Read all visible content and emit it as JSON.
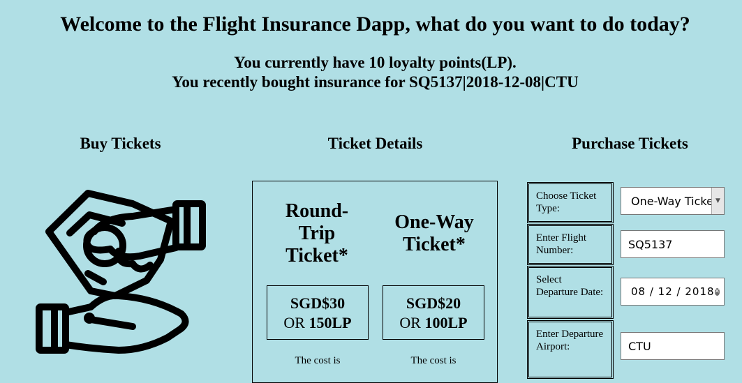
{
  "header": {
    "title": "Welcome to the Flight Insurance Dapp, what do you want to do today?",
    "loyalty_line": "You currently have 10 loyalty points(LP).",
    "recent_line": "You recently bought insurance for SQ5137|2018-12-08|CTU"
  },
  "sections": {
    "buy": "Buy Tickets",
    "details": "Ticket Details",
    "purchase": "Purchase Tickets"
  },
  "tickets": {
    "round_trip": {
      "name": "Round-Trip Ticket*",
      "price": "SGD$30",
      "or_text": "OR",
      "points": "150LP",
      "note": "The cost is"
    },
    "one_way": {
      "name": "One-Way Ticket*",
      "price": "SGD$20",
      "or_text": "OR",
      "points": "100LP",
      "note": "The cost is"
    }
  },
  "form": {
    "ticket_type_label": "Choose Ticket Type:",
    "ticket_type_value": "One-Way Ticket",
    "flight_label": "Enter Flight Number:",
    "flight_value": "SQ5137",
    "date_label": "Select Departure Date:",
    "date_value": "08 / 12 / 2018",
    "airport_label": "Enter Departure Airport:",
    "airport_value": "CTU"
  },
  "icons": {
    "hands": "money-hands-icon",
    "dropdown": "chevron-down-icon",
    "clear": "clear-icon"
  }
}
